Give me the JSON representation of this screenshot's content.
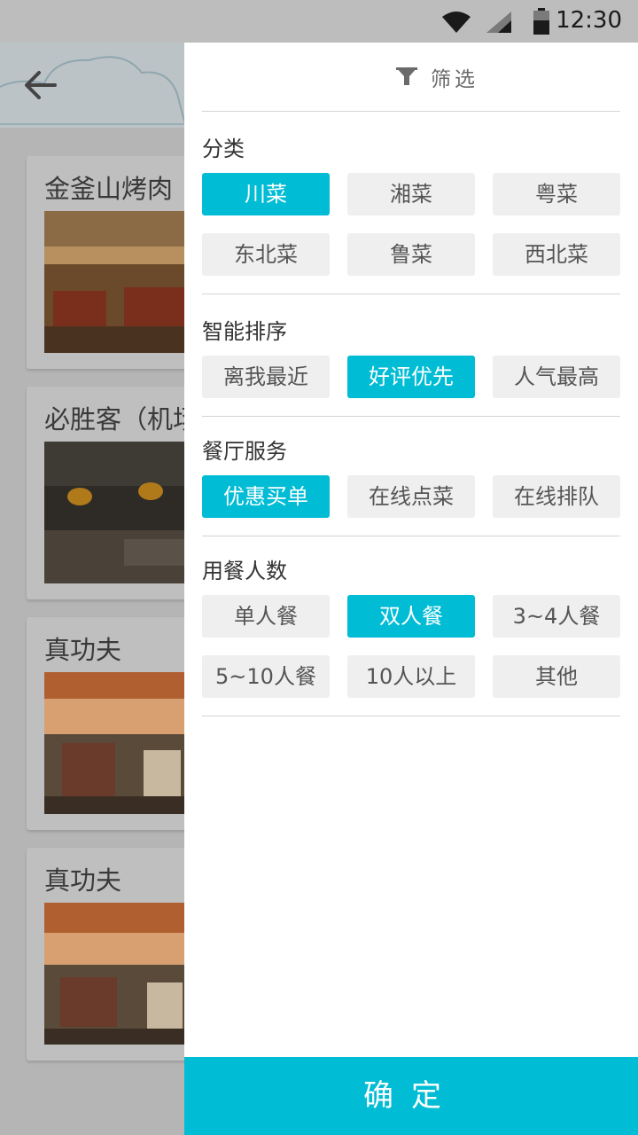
{
  "status_bar": {
    "time": "12:30"
  },
  "background": {
    "cards": [
      {
        "title": "金釜山烤肉"
      },
      {
        "title": "必胜客（机场"
      },
      {
        "title": "真功夫"
      },
      {
        "title": "真功夫"
      }
    ]
  },
  "drawer": {
    "title": "筛选",
    "sections": [
      {
        "title": "分类",
        "options": [
          "川菜",
          "湘菜",
          "粤菜",
          "东北菜",
          "鲁菜",
          "西北菜"
        ],
        "selected": "川菜"
      },
      {
        "title": "智能排序",
        "options": [
          "离我最近",
          "好评优先",
          "人气最高"
        ],
        "selected": "好评优先"
      },
      {
        "title": "餐厅服务",
        "options": [
          "优惠买单",
          "在线点菜",
          "在线排队"
        ],
        "selected": "优惠买单"
      },
      {
        "title": "用餐人数",
        "options": [
          "单人餐",
          "双人餐",
          "3~4人餐",
          "5~10人餐",
          "10人以上",
          "其他"
        ],
        "selected": "双人餐"
      }
    ],
    "confirm_label": "确定"
  },
  "colors": {
    "accent": "#00bcd4",
    "option_bg": "#efefef"
  }
}
